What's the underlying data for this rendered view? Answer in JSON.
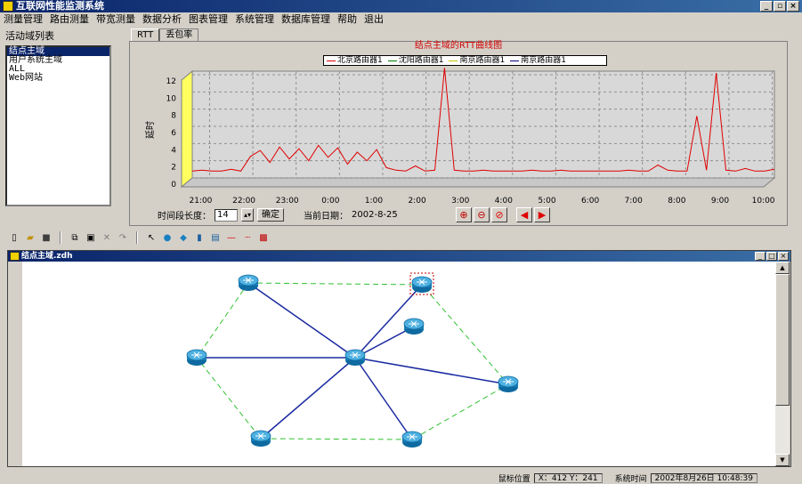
{
  "window": {
    "title": "互联网性能监测系统",
    "min": "_",
    "max": "▫",
    "close": "×"
  },
  "menu": [
    "测量管理",
    "路由测量",
    "带宽测量",
    "数据分析",
    "图表管理",
    "系统管理",
    "数据库管理",
    "帮助",
    "退出"
  ],
  "left_panel": {
    "label": "活动域列表",
    "items": [
      "结点主域",
      "用户系统主域",
      "ALL",
      "Web网站"
    ],
    "selected_index": 0
  },
  "tabs": [
    "RTT",
    "丢包率"
  ],
  "chart_data": {
    "type": "line",
    "title": "结点主域的RTT曲线图",
    "ylabel": "延时",
    "ylim": [
      0,
      12
    ],
    "yticks": [
      "0",
      "2",
      "4",
      "6",
      "8",
      "10",
      "12"
    ],
    "xticks": [
      "21:00",
      "22:00",
      "23:00",
      "0:00",
      "1:00",
      "2:00",
      "3:00",
      "4:00",
      "5:00",
      "6:00",
      "7:00",
      "8:00",
      "9:00",
      "10:00"
    ],
    "x_start": "20:20",
    "x_end": "10:20",
    "legend": [
      {
        "name": "北京路由器1",
        "color": "#e00000"
      },
      {
        "name": "沈阳路由器1",
        "color": "#008000"
      },
      {
        "name": "南京路由器1",
        "color": "#c0c000"
      },
      {
        "name": "南京路由器1",
        "color": "#000080"
      }
    ],
    "series": [
      {
        "name": "北京路由器1",
        "color": "#e00000",
        "values": [
          0.8,
          0.9,
          0.8,
          0.8,
          1.0,
          0.8,
          2.5,
          3.2,
          1.8,
          3.6,
          2.2,
          3.4,
          2.0,
          3.8,
          2.4,
          3.5,
          1.6,
          3.0,
          2.0,
          3.3,
          1.2,
          0.9,
          0.8,
          1.4,
          0.8,
          0.9,
          12.8,
          0.9,
          0.8,
          0.8,
          0.9,
          0.8,
          0.8,
          0.8,
          0.8,
          0.9,
          0.8,
          0.8,
          0.9,
          0.8,
          0.8,
          0.8,
          0.8,
          0.8,
          0.8,
          0.9,
          0.8,
          0.8,
          1.5,
          0.9,
          0.8,
          0.8,
          7.2,
          0.9,
          12.2,
          0.9,
          0.8,
          1.1,
          0.8,
          0.8,
          1.0
        ]
      }
    ]
  },
  "controls": {
    "time_len_label": "时间段长度：",
    "time_len_value": "14",
    "ok_button": "确定",
    "date_label": "当前日期：",
    "date_value": "2002-8-25"
  },
  "mdi": {
    "title": "结点主域.zdh",
    "min": "_",
    "max": "□",
    "close": "×"
  },
  "network": {
    "center": "hub-router",
    "routers": [
      "router-top-left",
      "router-top-right",
      "router-inner-right",
      "router-left",
      "router-right",
      "router-bottom-left",
      "router-bottom-right",
      "router-hub"
    ],
    "links_solid": [
      "router-top-left",
      "router-top-right",
      "router-inner-right",
      "router-left",
      "router-right",
      "router-bottom-left",
      "router-bottom-right"
    ],
    "ring_dashed": [
      "router-top-left",
      "router-top-right",
      "router-right",
      "router-bottom-right",
      "router-bottom-left",
      "router-left"
    ]
  },
  "status": {
    "mouse_label": "鼠标位置",
    "mouse_value": "X：412  Y：241",
    "time_label": "系统时间",
    "time_value": "2002年8月26日 10:48:39"
  }
}
